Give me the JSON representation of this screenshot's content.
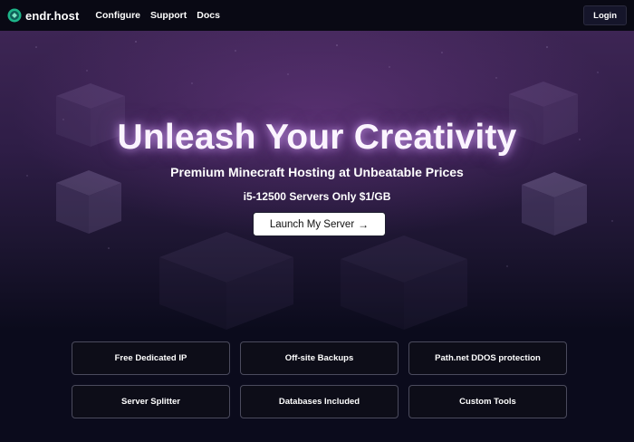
{
  "nav": {
    "brand": "endr.host",
    "links": [
      "Configure",
      "Support",
      "Docs"
    ],
    "login_label": "Login"
  },
  "hero": {
    "title": "Unleash Your Creativity",
    "subtitle": "Premium Minecraft Hosting at Unbeatable Prices",
    "tagline": "i5-12500 Servers Only $1/GB",
    "cta_label": "Launch My Server",
    "cta_icon": "arrow-right-icon"
  },
  "features": [
    "Free Dedicated IP",
    "Off-site Backups",
    "Path.net DDOS protection",
    "Server Splitter",
    "Databases Included",
    "Custom Tools"
  ],
  "colors": {
    "page_bg": "#0b0b1c",
    "nav_bg": "#090914",
    "hero_top": "#3d2554",
    "title_glow": "#dcaaff",
    "logo_green": "#1db489",
    "card_border": "#4b4b5d"
  }
}
